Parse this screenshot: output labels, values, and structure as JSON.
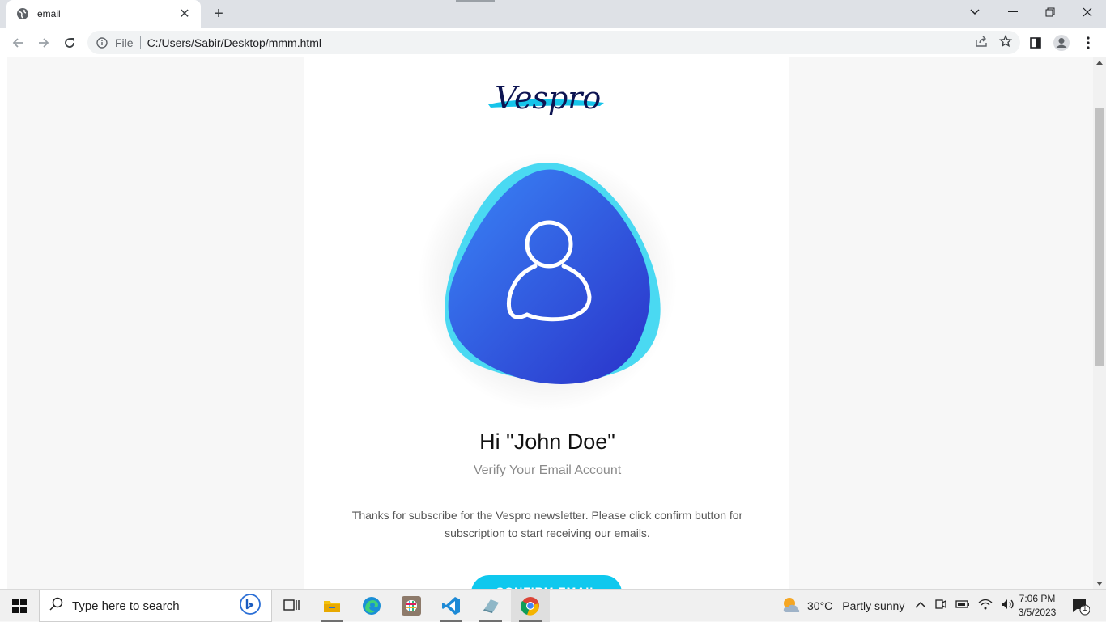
{
  "browser": {
    "tab_title": "email",
    "url_scheme_label": "File",
    "url": "C:/Users/Sabir/Desktop/mmm.html"
  },
  "email": {
    "logo_text": "Vespro",
    "greeting": "Hi \"John Doe\"",
    "subtitle": "Verify Your Email Account",
    "body": "Thanks for subscribe for the Vespro newsletter. Please click confirm button for subscription to start receiving our emails.",
    "confirm_label": "CONFIRM EMAIL"
  },
  "taskbar": {
    "search_placeholder": "Type here to search",
    "weather_temp": "30°C",
    "weather_desc": "Partly sunny",
    "time": "7:06 PM",
    "date": "3/5/2023",
    "notification_count": "1"
  },
  "colors": {
    "accent_cyan": "#0fc8ee",
    "blob_blue": "#2a5de6",
    "logo_navy": "#0d1452"
  }
}
